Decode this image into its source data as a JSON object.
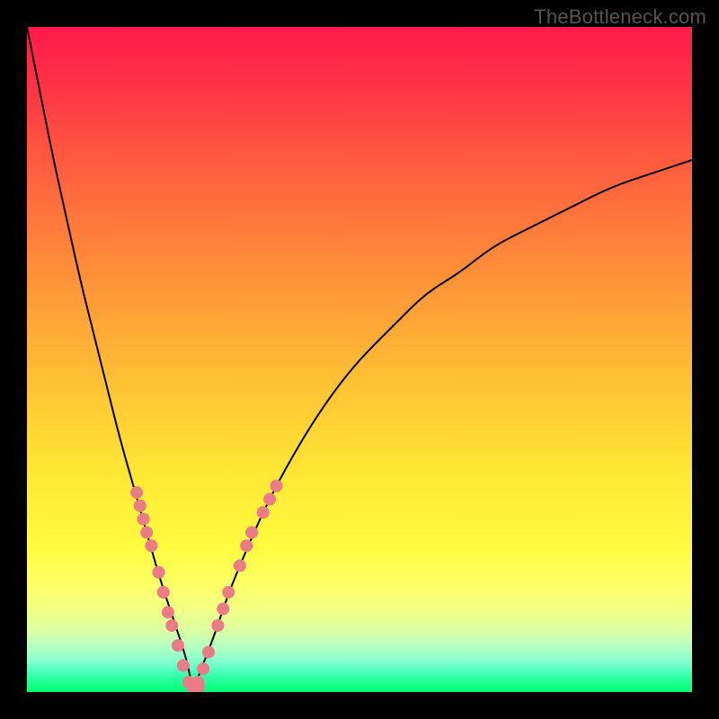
{
  "watermark": "TheBottleneck.com",
  "colors": {
    "frame": "#000000",
    "curve": "#000000",
    "marker": "#e97c86",
    "gradient_top": "#ff1a4b",
    "gradient_mid": "#ffe934",
    "gradient_bottom": "#00ff75"
  },
  "chart_data": {
    "type": "line",
    "title": "",
    "xlabel": "",
    "ylabel": "",
    "xlim": [
      0,
      100
    ],
    "ylim": [
      0,
      100
    ],
    "grid": false,
    "legend": false,
    "description": "V-shaped bottleneck curve over a vertical red-yellow-green gradient. Minimum (0%) at x≈25. Left branch rises steeply to 100% at x=0. Right branch rises with decreasing slope toward ~80% at x=100. Salmon-colored sample markers cluster along both branches in the lower region (y ≲ 32%).",
    "x": [
      0,
      2,
      4,
      6,
      8,
      10,
      12,
      14,
      16,
      18,
      20,
      22,
      24,
      25,
      26,
      28,
      30,
      32,
      35,
      38,
      42,
      46,
      50,
      55,
      60,
      65,
      70,
      76,
      82,
      88,
      94,
      100
    ],
    "values": [
      100,
      90,
      80,
      71,
      62,
      54,
      46,
      38,
      31,
      24,
      17,
      11,
      5,
      0,
      3,
      8,
      14,
      19,
      26,
      32,
      39,
      45,
      50,
      55,
      60,
      63,
      67,
      70,
      73,
      76,
      78,
      80
    ],
    "markers_left": [
      {
        "x": 16.5,
        "y": 30
      },
      {
        "x": 17.0,
        "y": 28
      },
      {
        "x": 17.5,
        "y": 26
      },
      {
        "x": 18.0,
        "y": 24
      },
      {
        "x": 18.7,
        "y": 22
      },
      {
        "x": 19.8,
        "y": 18
      },
      {
        "x": 20.5,
        "y": 15
      },
      {
        "x": 21.2,
        "y": 12
      },
      {
        "x": 21.8,
        "y": 10
      },
      {
        "x": 22.7,
        "y": 7
      },
      {
        "x": 23.5,
        "y": 4
      },
      {
        "x": 24.3,
        "y": 1.5
      }
    ],
    "markers_right": [
      {
        "x": 25.7,
        "y": 1.5
      },
      {
        "x": 26.5,
        "y": 3.5
      },
      {
        "x": 27.3,
        "y": 6
      },
      {
        "x": 28.7,
        "y": 10
      },
      {
        "x": 29.5,
        "y": 12.5
      },
      {
        "x": 30.3,
        "y": 15
      },
      {
        "x": 32.0,
        "y": 19
      },
      {
        "x": 33.0,
        "y": 22
      },
      {
        "x": 33.8,
        "y": 24
      },
      {
        "x": 35.5,
        "y": 27
      },
      {
        "x": 36.5,
        "y": 29
      },
      {
        "x": 37.5,
        "y": 31
      }
    ],
    "markers_bottom": [
      {
        "x": 25.0,
        "y": 0.5
      },
      {
        "x": 25.8,
        "y": 0.7
      }
    ]
  }
}
